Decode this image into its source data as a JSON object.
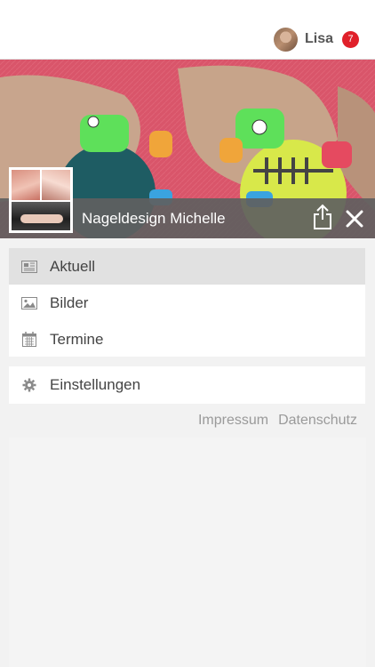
{
  "header": {
    "user_name": "Lisa",
    "notification_count": "7"
  },
  "hero": {
    "title": "Nageldesign Michelle"
  },
  "menu": {
    "items": [
      {
        "label": "Aktuell",
        "icon": "newspaper-icon",
        "active": true
      },
      {
        "label": "Bilder",
        "icon": "image-icon",
        "active": false
      },
      {
        "label": "Termine",
        "icon": "calendar-icon",
        "active": false
      }
    ],
    "settings": {
      "label": "Einstellungen",
      "icon": "gear-icon"
    }
  },
  "footer_links": {
    "impressum": "Impressum",
    "datenschutz": "Datenschutz"
  },
  "colors": {
    "badge": "#e0202a",
    "title_bar": "#5f5f5f",
    "active_item": "#e1e1e1"
  }
}
